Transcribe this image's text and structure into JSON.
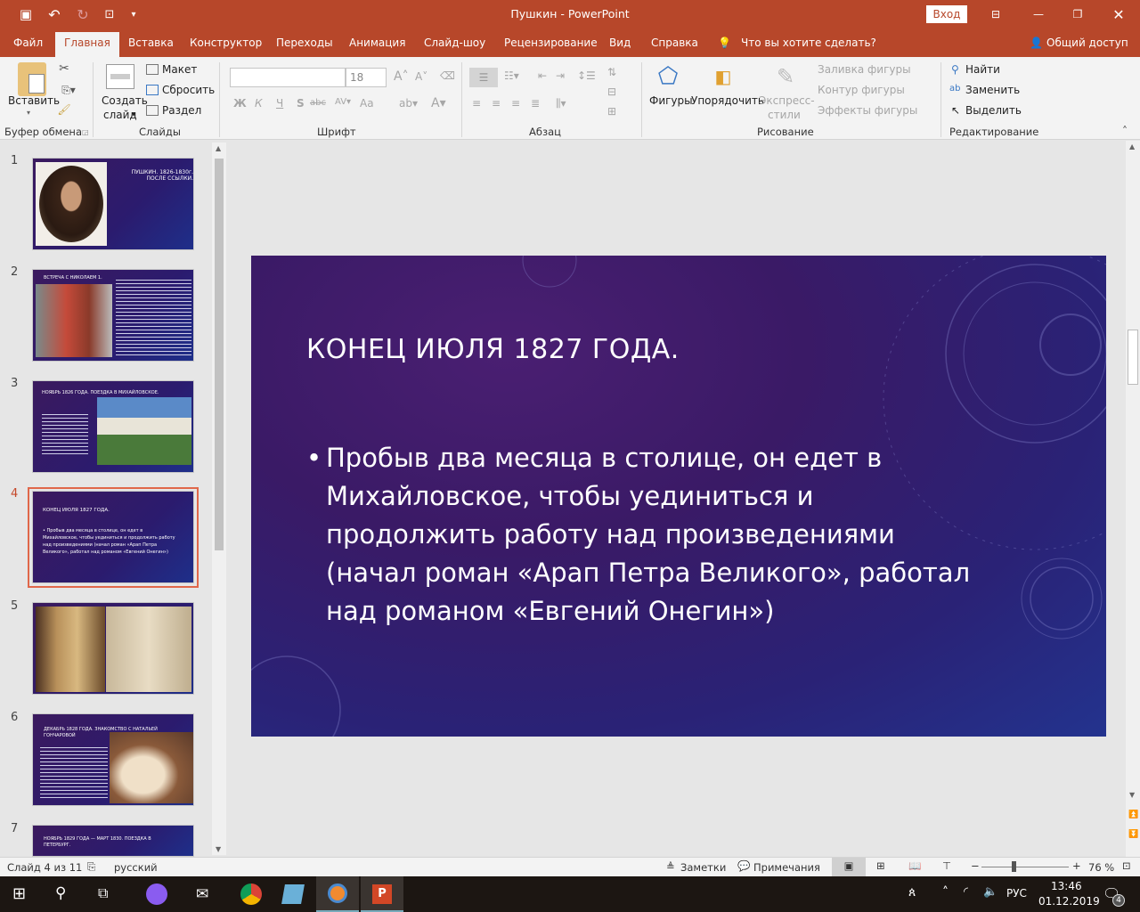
{
  "window": {
    "title": "Пушкин  -  PowerPoint",
    "signin": "Вход"
  },
  "tabs": [
    "Файл",
    "Главная",
    "Вставка",
    "Конструктор",
    "Переходы",
    "Анимация",
    "Слайд-шоу",
    "Рецензирование",
    "Вид",
    "Справка"
  ],
  "tellme": "Что вы хотите сделать?",
  "share": "Общий доступ",
  "ribbon": {
    "paste": "Вставить",
    "clipboard": "Буфер обмена",
    "new_slide_1": "Создать",
    "new_slide_2": "слайд",
    "layout": "Макет",
    "reset": "Сбросить",
    "section": "Раздел",
    "slides": "Слайды",
    "font_size": "18",
    "font": "Шрифт",
    "bold": "Ж",
    "italic": "К",
    "underline": "Ч",
    "shadow": "S",
    "strike": "abc",
    "case": "Aa",
    "paragraph": "Абзац",
    "shapes": "Фигуры",
    "arrange": "Упорядочить",
    "quick_1": "Экспресс-",
    "quick_2": "стили",
    "fill": "Заливка фигуры",
    "outline": "Контур фигуры",
    "effects": "Эффекты фигуры",
    "drawing": "Рисование",
    "find": "Найти",
    "replace": "Заменить",
    "select": "Выделить",
    "editing": "Редактирование"
  },
  "thumbnails": [
    {
      "num": "1",
      "title": "ПУШКИН. 1826-1830г. ПОСЛЕ ССЫЛКИ."
    },
    {
      "num": "2",
      "title": "ВСТРЕЧА С НИКОЛАЕМ 1."
    },
    {
      "num": "3",
      "title": "НОЯБРЬ 1826 ГОДА. ПОЕЗДКА В МИХАЙЛОВСКОЕ."
    },
    {
      "num": "4",
      "title": "КОНЕЦ ИЮЛЯ 1827 ГОДА.",
      "body": "• Пробыв два месяца в столице, он едет в Михайловское, чтобы уединиться и продолжить работу над произведениями (начал роман «Арап Петра Великого», работал над романом «Евгений Онегин»)"
    },
    {
      "num": "5",
      "title": ""
    },
    {
      "num": "6",
      "title": "ДЕКАБРЬ 1828 ГОДА. ЗНАКОМСТВО С НАТАЛЬЕЙ ГОНЧАРОВОЙ"
    },
    {
      "num": "7",
      "title": "НОЯБРЬ 1829 ГОДА — МАРТ 1830. ПОЕЗДКА В ПЕТЕРБУРГ."
    }
  ],
  "slide": {
    "title": "КОНЕЦ ИЮЛЯ 1827 ГОДА.",
    "bullet": "Пробыв два месяца в столице, он едет в Михайловское, чтобы уединиться и продолжить работу над произведениями (начал роман «Арап Петра Великого», работал над романом «Евгений Онегин»)"
  },
  "status": {
    "slide_of": "Слайд 4 из 11",
    "language": "русский",
    "notes": "Заметки",
    "comments": "Примечания",
    "zoom": "76 %",
    "zoom_value": 76
  },
  "taskbar": {
    "lang": "РУС",
    "time": "13:46",
    "date": "01.12.2019",
    "notifications": "4"
  },
  "colors": {
    "accent": "#b7472a",
    "selected_border": "#e0674a"
  }
}
